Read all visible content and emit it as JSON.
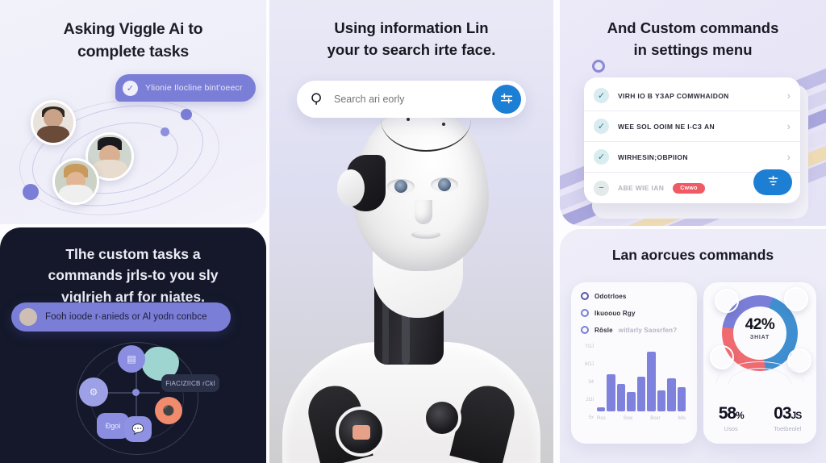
{
  "panel_asking": {
    "title_line1": "Asking Viggle Ai to",
    "title_line2": "complete tasks",
    "bubble_text": "Ylionie Ilocline bint'oeecr",
    "bubble_icon": "chat-check-icon"
  },
  "panel_dark": {
    "title_line1": "Tlhe custom tasks a",
    "title_line2": "commands jrl­s‑to you sly",
    "title_line3": "viglrjeh arf for niates.",
    "bubble_text": "Fooh ioode r·anieds or Al yodn conbce",
    "network": {
      "tag_label": "FiACIZIICB rCkا",
      "node_bl_label": "Đɡoi",
      "nodes": [
        "grid-node-icon",
        "sliders-node-icon",
        "doc-node-icon",
        "chat-node-icon",
        "person-node-icon"
      ]
    }
  },
  "panel_center": {
    "title_line1": "Using information Lin",
    "title_line2": "your to search irte face.",
    "search_placeholder": "Search ari eorly",
    "search_value": "",
    "search_icon": "search-icon",
    "action_icon": "filter-icon",
    "action_color": "#1d7fd4"
  },
  "panel_settings": {
    "title_line1": "And Custom commands",
    "title_line2": "in settings menu",
    "marker_icon": "circle-outline-icon",
    "rows": [
      {
        "label": "VIRΗ IΟ Β YЗAP COMWHAIDON",
        "icon": "check-circle-icon",
        "chevron": "chevron-right-icon",
        "dim": false
      },
      {
        "label": "WEE SOL OOIM NE I-CЗ AN",
        "icon": "check-circle-icon",
        "chevron": "chevron-right-icon",
        "dim": false
      },
      {
        "label": "WIRHESIN;OВРIION",
        "icon": "check-circle-icon",
        "chevron": "chevron-right-icon",
        "dim": false
      },
      {
        "label": "AВE WIE ІAN",
        "icon": "minus-circle-icon",
        "badge": "Cwwo",
        "dim": true
      }
    ],
    "fab_icon": "add-filter-icon",
    "fab_color": "#1d7fd4",
    "badge_color": "#ef5a63"
  },
  "panel_dashboard": {
    "title": "Lan aorcues commands",
    "legend": [
      {
        "label": "Odotrloes",
        "color": "#5a5aa8"
      },
      {
        "label": "Ikuoouo Rgy",
        "color": "#7b7ed6"
      },
      {
        "label": "Rôsle",
        "sub": "witlarly Ѕaosrfen?",
        "color": "#7b7ed6"
      }
    ],
    "stats": [
      {
        "value": "58",
        "unit": "%",
        "label": "Usos"
      },
      {
        "value": "03",
        "unit": "JS",
        "label": "Toetbeolel"
      }
    ],
    "donut": {
      "percent": "42%",
      "caption": "ЗНIAT"
    }
  },
  "chart_data": [
    {
      "type": "bar",
      "title": "",
      "xlabel": "",
      "ylabel": "",
      "categories": [
        "Rso",
        "Sxw",
        "Boxr",
        "Mis",
        "",
        "",
        "",
        "",
        ""
      ],
      "tick_labels_x": [
        "Rso",
        "Sxw",
        "Boxr",
        "Mis"
      ],
      "tick_labels_y": [
        "7OJ",
        "6OJ",
        "34",
        "2OI",
        "5x"
      ],
      "values": [
        4,
        38,
        28,
        20,
        36,
        62,
        22,
        34,
        25
      ],
      "ylim": [
        0,
        70
      ],
      "grid": false,
      "legend": [
        "Odotrloes",
        "Ikuoouo Rgy",
        "Rôsle"
      ],
      "legend_position": "top",
      "bar_color": "#7f82dc"
    },
    {
      "type": "pie",
      "title": "42%",
      "subtitle": "ЗНIAT",
      "labels": [
        "segment-blue",
        "segment-red",
        "segment-purple"
      ],
      "values": [
        42,
        30,
        28
      ],
      "colors": [
        "#3f8fd0",
        "#ef6b70",
        "#7b7ed6"
      ],
      "legend_position": "none"
    }
  ]
}
